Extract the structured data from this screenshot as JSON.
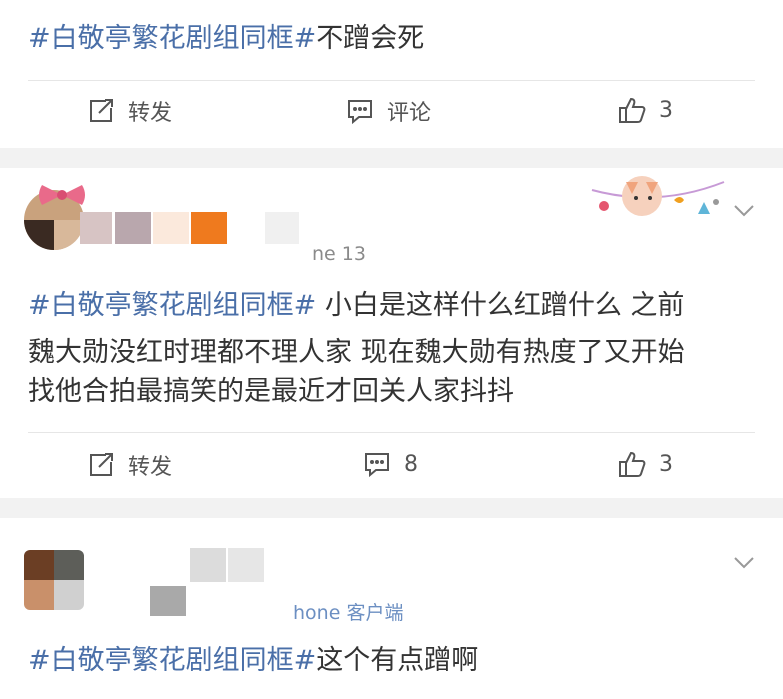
{
  "posts": [
    {
      "hashtag": "#白敬亭繁花剧组同框#",
      "body": "不蹭会死",
      "actions": {
        "repost": "转发",
        "comment": "评论",
        "like": "3"
      }
    },
    {
      "meta_fragment": "ne 13",
      "hashtag": "#白敬亭繁花剧组同框#",
      "line1": " 小白是这样什么红蹭什么 之前",
      "line2": "魏大勋没红时理都不理人家 现在魏大勋有热度了又开始",
      "line3": "找他合拍最搞笑的是最近才回关人家抖抖",
      "actions": {
        "repost": "转发",
        "comment": "8",
        "like": "3"
      }
    },
    {
      "meta_fragment": "hone 客户端",
      "hashtag": "#白敬亭繁花剧组同框#",
      "body": "这个有点蹭啊"
    }
  ],
  "colors": {
    "hashtag": "#4a6fa8",
    "background": "#f2f2f2",
    "text": "#333333"
  }
}
